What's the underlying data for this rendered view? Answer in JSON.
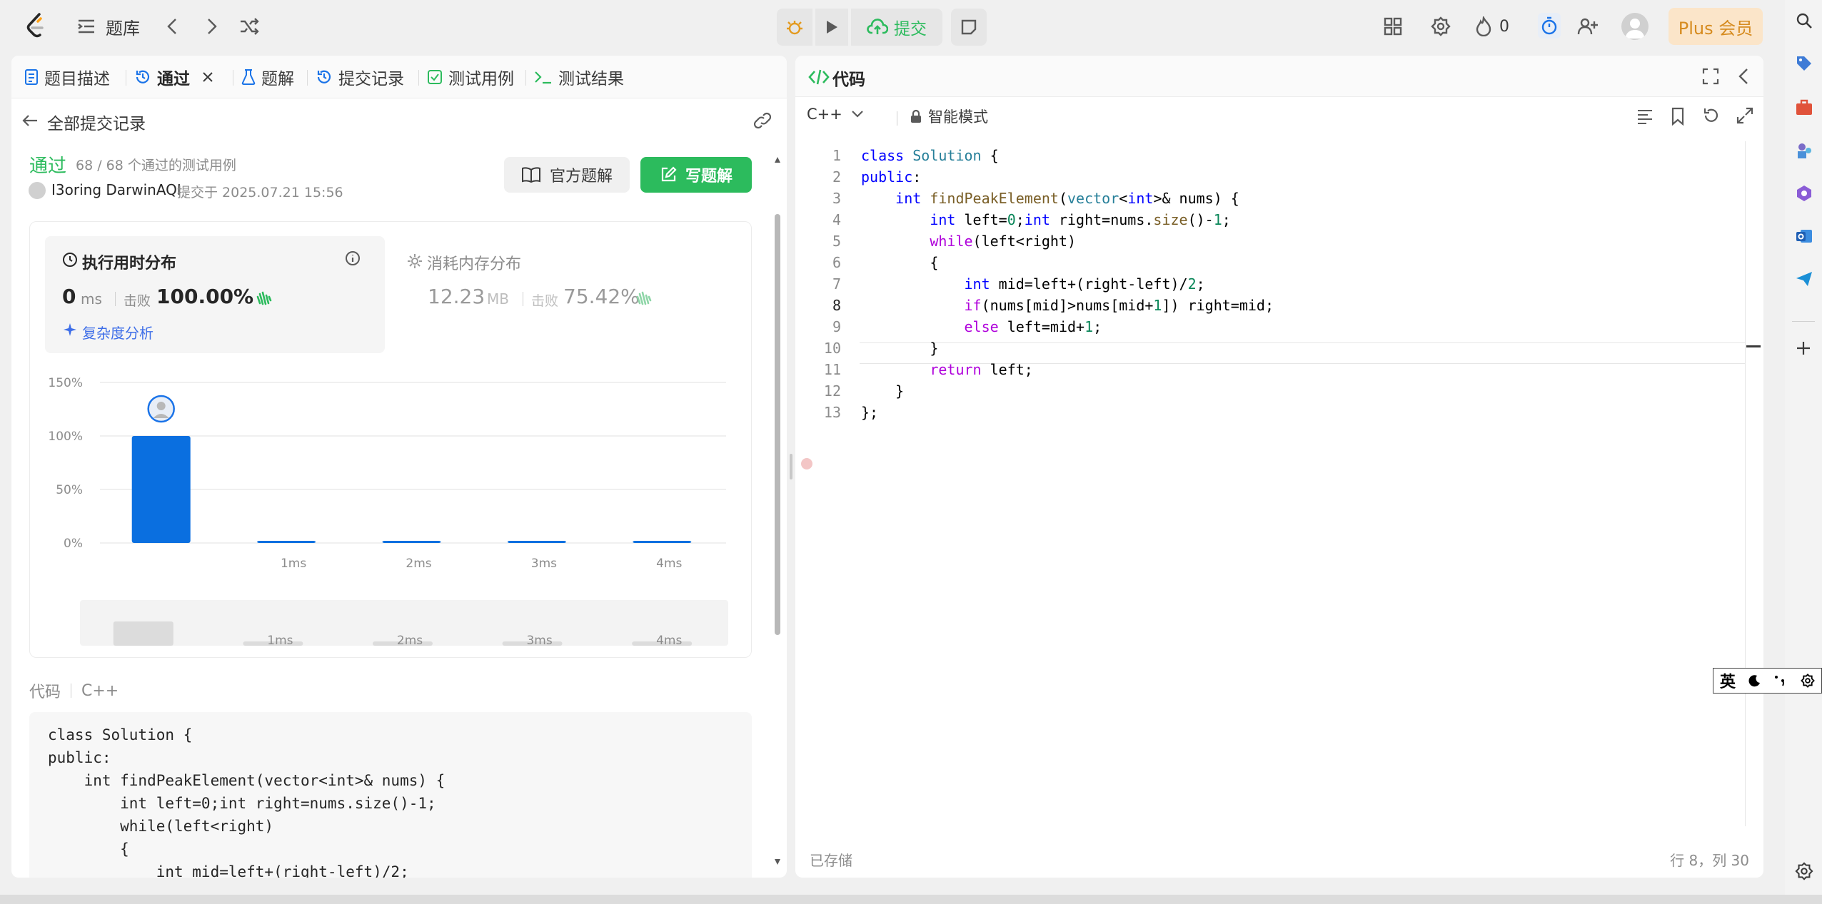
{
  "topbar": {
    "problem_bank": "题库",
    "submit_label": "提交",
    "streak_count": "0",
    "plus_label": "Plus 会员"
  },
  "tabs": [
    {
      "label": "题目描述"
    },
    {
      "label": "通过"
    },
    {
      "label": "题解"
    },
    {
      "label": "提交记录"
    },
    {
      "label": "测试用例"
    },
    {
      "label": "测试结果"
    }
  ],
  "submission": {
    "back_label": "全部提交记录",
    "status": "通过",
    "passed_text": "68 / 68 个通过的测试用例",
    "user": "I3oring DarwinAQI",
    "submitted_at": "提交于 2025.07.21 15:56",
    "official_solution": "官方题解",
    "write_solution": "写题解"
  },
  "runtime": {
    "title": "执行用时分布",
    "value": "0",
    "unit": "ms",
    "beat_label": "击败",
    "beat_pct": "100.00%",
    "complexity": "复杂度分析"
  },
  "memory": {
    "title": "消耗内存分布",
    "value": "12.23",
    "unit": "MB",
    "beat_label": "击败",
    "beat_pct": "75.42%"
  },
  "chart_data": {
    "type": "bar",
    "categories": [
      "0ms",
      "1ms",
      "2ms",
      "3ms",
      "4ms"
    ],
    "x_tick_labels": [
      "",
      "1ms",
      "2ms",
      "3ms",
      "4ms"
    ],
    "values": [
      100,
      2,
      2,
      2,
      2
    ],
    "ylim": [
      0,
      150
    ],
    "y_ticks": [
      "0%",
      "50%",
      "100%",
      "150%"
    ],
    "grid": true,
    "bar_color": "#0a6fe0"
  },
  "code_section": {
    "label": "代码",
    "lang": "C++",
    "preview_lines": [
      "class Solution {",
      "public:",
      "    int findPeakElement(vector<int>& nums) {",
      "        int left=0;int right=nums.size()-1;",
      "        while(left<right)",
      "        {",
      "            int mid=left+(right-left)/2;"
    ]
  },
  "editor": {
    "title": "代码",
    "language": "C++",
    "mode": "智能模式",
    "status_saved": "已存储",
    "cursor_pos": "行 8，列 30",
    "line_numbers": [
      "1",
      "2",
      "3",
      "4",
      "5",
      "6",
      "7",
      "8",
      "9",
      "10",
      "11",
      "12",
      "13"
    ]
  },
  "ime": {
    "label": "英"
  },
  "colors": {
    "accent_green": "#2cbb5d",
    "bar_blue": "#0a6fe0",
    "plus_orange": "#d68b1f"
  }
}
